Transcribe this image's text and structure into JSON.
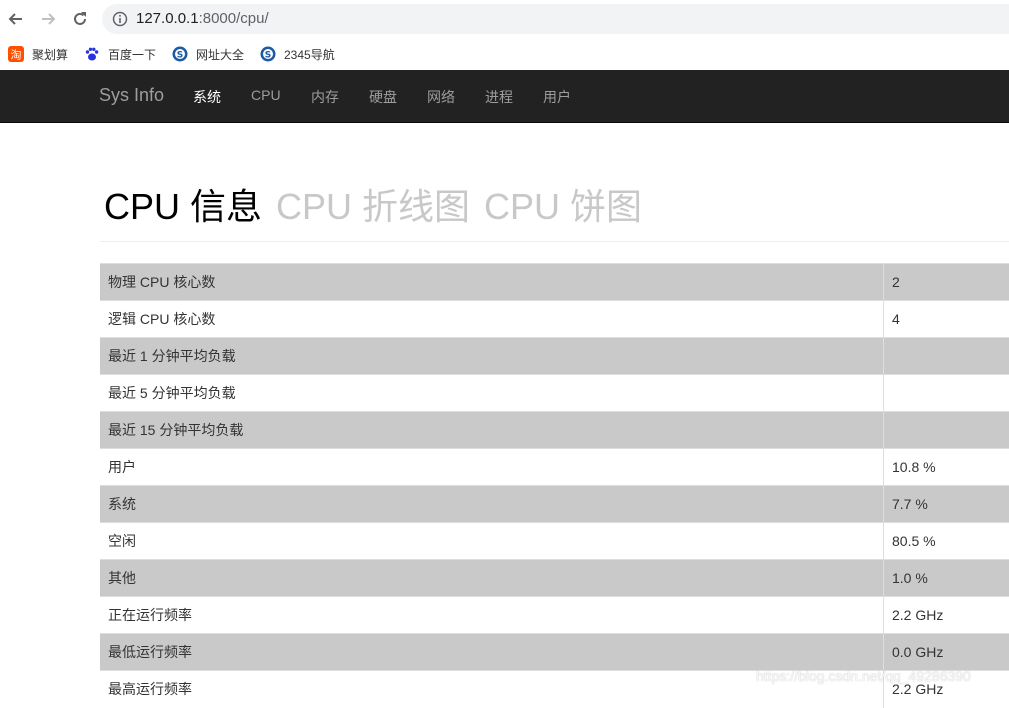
{
  "browser": {
    "url_host": "127.0.0.1",
    "url_rest": ":8000/cpu/",
    "bookmarks": [
      {
        "label": "聚划算",
        "icon": "taobao-icon"
      },
      {
        "label": "百度一下",
        "icon": "baidu-paw-icon"
      },
      {
        "label": "网址大全",
        "icon": "sogou-icon"
      },
      {
        "label": "2345导航",
        "icon": "sogou-icon"
      }
    ]
  },
  "navbar": {
    "brand": "Sys Info",
    "items": [
      "系统",
      "CPU",
      "内存",
      "硬盘",
      "网络",
      "进程",
      "用户"
    ]
  },
  "header": {
    "title": "CPU 信息",
    "tabs": [
      "CPU 折线图",
      "CPU 饼图"
    ]
  },
  "table": {
    "rows": [
      {
        "label": "物理 CPU 核心数",
        "value": "2"
      },
      {
        "label": "逻辑 CPU 核心数",
        "value": "4"
      },
      {
        "label": "最近 1 分钟平均负载",
        "value": ""
      },
      {
        "label": "最近 5 分钟平均负载",
        "value": ""
      },
      {
        "label": "最近 15 分钟平均负载",
        "value": ""
      },
      {
        "label": "用户",
        "value": "10.8 %"
      },
      {
        "label": "系统",
        "value": "7.7 %"
      },
      {
        "label": "空闲",
        "value": "80.5 %"
      },
      {
        "label": "其他",
        "value": "1.0 %"
      },
      {
        "label": "正在运行频率",
        "value": "2.2 GHz"
      },
      {
        "label": "最低运行频率",
        "value": "0.0 GHz"
      },
      {
        "label": "最高运行频率",
        "value": "2.2 GHz"
      }
    ]
  },
  "watermark": "https://blog.csdn.net/qq_49286390",
  "colors": {
    "navbar_bg": "#222222",
    "nav_active": "#ffffff",
    "nav_inactive": "#9d9d9d",
    "row_stripe": "#c9c9c9"
  }
}
